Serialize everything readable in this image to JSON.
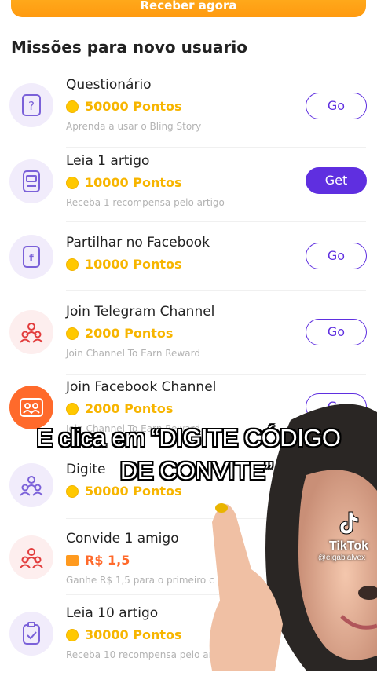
{
  "top_button": {
    "label": "Receber agora"
  },
  "section_title": "Missões para novo usuario",
  "missions": [
    {
      "title": "Questionário",
      "reward": "50000 Pontos",
      "subtitle": "Aprenda a usar o Bling Story",
      "action": "Go",
      "icon": "question-icon"
    },
    {
      "title": "Leia 1 artigo",
      "reward": "10000 Pontos",
      "subtitle": "Receba 1 recompensa pelo artigo",
      "action": "Get",
      "icon": "book-icon"
    },
    {
      "title": "Partilhar no Facebook",
      "reward": "10000 Pontos",
      "subtitle": "",
      "action": "Go",
      "icon": "facebook-icon"
    },
    {
      "title": "Join Telegram Channel",
      "reward": "2000 Pontos",
      "subtitle": "Join Channel To Earn Reward",
      "action": "Go",
      "icon": "group-icon"
    },
    {
      "title": "Join Facebook Channel",
      "reward": "2000 Pontos",
      "subtitle": "Join Channel To Earn Reward",
      "action": "Go",
      "icon": "group-icon"
    },
    {
      "title": "Digite",
      "reward": "50000 Pontos",
      "subtitle": "",
      "action": "",
      "icon": "group-icon"
    },
    {
      "title": "Convide 1 amigo",
      "reward": "R$ 1,5",
      "subtitle": "Ganhe R$ 1,5 para o primeiro c",
      "action": "",
      "icon": "group-icon"
    },
    {
      "title": "Leia 10 artigo",
      "reward": "30000 Pontos",
      "subtitle": "Receba 10 recompensa pelo artigo",
      "action": "",
      "icon": "clipboard-check-icon"
    }
  ],
  "caption": {
    "line1": "E clica em “DIGITE CÓDIGO",
    "line2": "DE CONVITE”"
  },
  "watermark": {
    "brand": "TikTok",
    "user": "@eigabialvex"
  },
  "colors": {
    "accent": "#5f2fe0",
    "coin": "#f7b500",
    "orange": "#ff9a10"
  }
}
